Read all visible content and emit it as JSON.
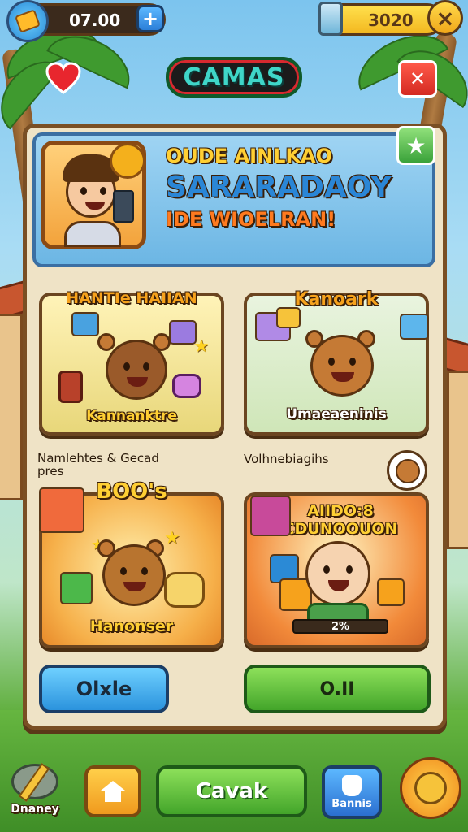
{
  "header": {
    "coins_value": "07.00",
    "plus_label": "+",
    "gems_value": "3020",
    "close_label": "×",
    "title": "CAMAS",
    "exit_label": "✕"
  },
  "banner": {
    "line1": "OUDE AINLKAO",
    "line2": "SARARADAOY",
    "line3": "IDE WIOELRAN!"
  },
  "cards": [
    {
      "title": "HANTIe HAIIAN",
      "subtitle": "Kannanktre"
    },
    {
      "title": "Kanoark",
      "subtitle": "Umaeaeninis"
    },
    {
      "title": "BOO's",
      "subtitle": "Hanonser"
    },
    {
      "title": "AIIDO:8 CDUNOOUON",
      "subtitle": "",
      "progress_text": "2%"
    }
  ],
  "section_labels": {
    "left": "Namlehtes & Gecad\npres",
    "right": "Volhnebiagihs"
  },
  "buttons": {
    "left": "Olxle",
    "right": "O.II"
  },
  "bottom_bar": {
    "left_label": "Dnaney",
    "center_label": "Cavak",
    "right_label": "Bannis"
  },
  "icons": [
    "coin-icon",
    "plus-icon",
    "gem-jar-icon",
    "close-icon",
    "heart-icon",
    "exit-icon",
    "star-icon",
    "home-icon",
    "hand-icon",
    "profile-icon",
    "pencil-icon"
  ],
  "colors": {
    "blue_button": "#39a8ea",
    "green_button": "#4cb832",
    "gold": "#f6a21c",
    "exit_red": "#e0342a"
  }
}
